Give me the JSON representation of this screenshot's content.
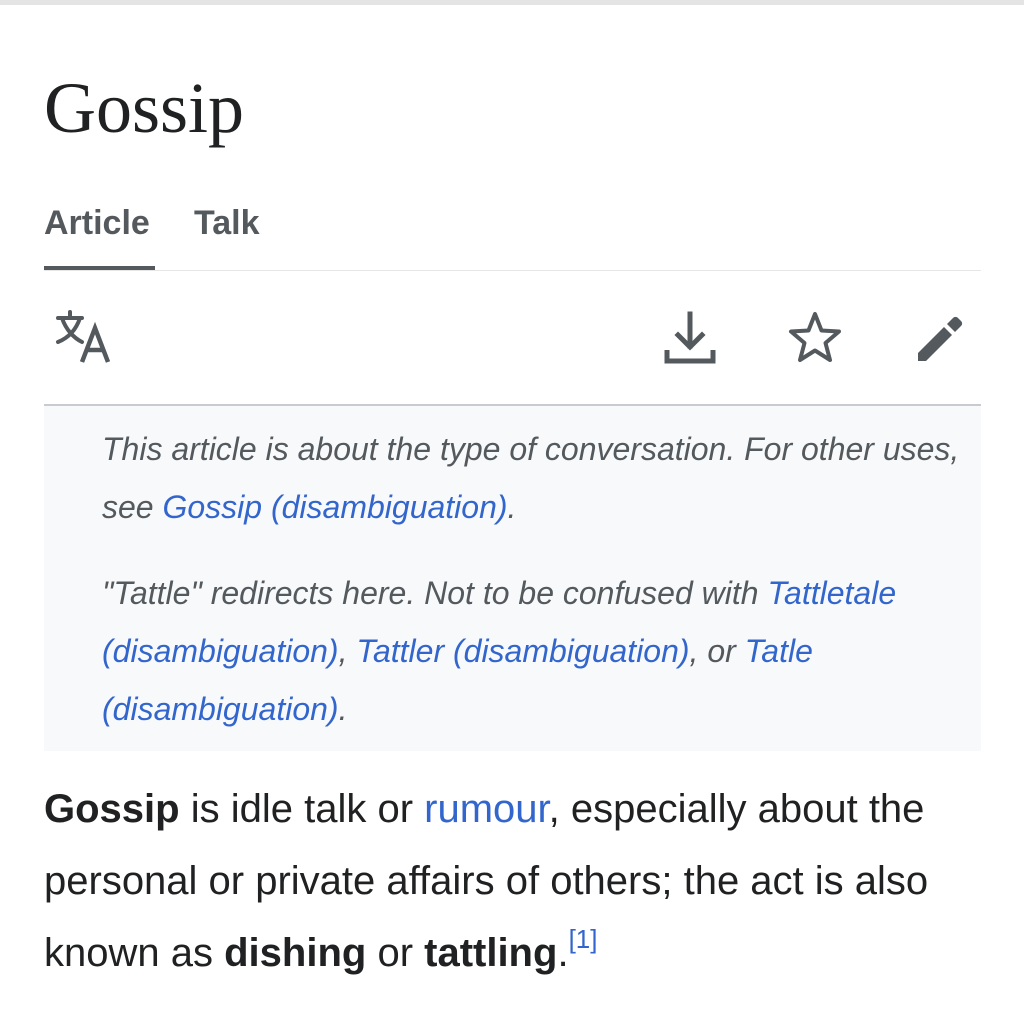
{
  "page": {
    "title": "Gossip"
  },
  "tabs": [
    {
      "label": "Article",
      "selected": true
    },
    {
      "label": "Talk",
      "selected": false
    }
  ],
  "toolbar": {
    "icons": [
      "language-icon",
      "download-icon",
      "star-icon",
      "edit-pencil-icon"
    ],
    "icon_color": "#54595d"
  },
  "hatnotes": {
    "first": {
      "text_before": "This article is about the type of conversation. For other uses, see ",
      "link": "Gossip (disambiguation)",
      "text_after": "."
    },
    "second": {
      "text_before": "\"Tattle\" redirects here. Not to be confused with ",
      "link1": "Tattletale (disambiguation)",
      "sep1": ", ",
      "link2": "Tattler (disambiguation)",
      "sep2": ", or ",
      "link3": "Tatle (disambiguation)",
      "text_after": "."
    }
  },
  "lead": {
    "term": "Gossip",
    "text1": " is idle talk or ",
    "link": "rumour",
    "text2": ", especially about the personal or private affairs of others; the act is also known as ",
    "bold1": "dishing",
    "text3": " or ",
    "bold2": "tattling",
    "text4": ".",
    "ref": "[1]"
  },
  "colors": {
    "link": "#3366cc",
    "text": "#202122",
    "muted": "#54595d",
    "hatnote_bg": "#f8f9fa"
  }
}
